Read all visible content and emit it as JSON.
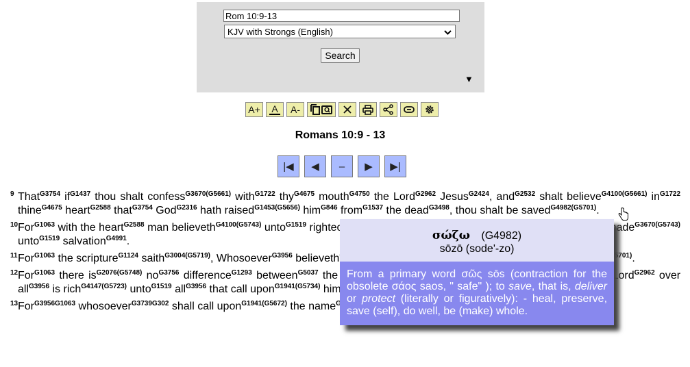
{
  "search": {
    "reference_value": "Rom 10:9-13",
    "version_selected": "KJV with Strongs (English)",
    "search_label": "Search",
    "toggle_icon": "▼"
  },
  "toolbar": {
    "font_increase": "A+",
    "font_default": "A",
    "font_decrease": "A-",
    "buttons": [
      "font-increase",
      "font-default",
      "font-decrease",
      "copy-search",
      "close",
      "print",
      "share",
      "link",
      "settings"
    ]
  },
  "passage": {
    "title": "Romans 10:9 - 13"
  },
  "nav": {
    "first": "|◀",
    "prev": "◀",
    "middle": "–",
    "next": "▶",
    "last": "▶|"
  },
  "verses": [
    {
      "num": "9",
      "html": "That<sup>G3754</sup> if<sup>G1437</sup> thou shalt confess<sup>G3670(G5661)</sup> with<sup>G1722</sup> thy<sup>G4675</sup> mouth<sup>G4750</sup> the Lord<sup>G2962</sup> Jesus<sup>G2424</sup>, and<sup>G2532</sup> shalt believe<sup>G4100(G5661)</sup> in<sup>G1722</sup> thine<sup>G4675</sup> heart<sup>G2588</sup> that<sup>G3754</sup> God<sup>G2316</sup> hath raised<sup>G1453(G5656)</sup> him<sup>G846</sup> from<sup>G1537</sup> the dead<sup>G3498</sup>, thou shalt be saved<sup>G4982(G5701)</sup>."
    },
    {
      "num": "10",
      "html": "For<sup>G1063</sup> with the heart<sup>G2588</sup> man believeth<sup>G4100(G5743)</sup> unto<sup>G1519</sup> righteousness<sup>G1343</sup>; and<sup>G1161</sup> with the mouth<sup>G4750</sup> confession is made<sup>G3670(G5743)</sup> unto<sup>G1519</sup> salvation<sup>G4991</sup>."
    },
    {
      "num": "11",
      "html": "For<sup>G1063</sup> the scripture<sup>G1124</sup> saith<sup>G3004(G5719)</sup>, Whosoever<sup>G3956</sup> believeth<sup>G4100(G5723)</sup> on<sup>G1909</sup> him<sup>G846</sup> shall not<sup>G3756</sup> be ashamed<sup>G2617(G5701)</sup>."
    },
    {
      "num": "12",
      "html": "For<sup>G1063</sup> there is<sup>G2076(G5748)</sup> no<sup>G3756</sup> difference<sup>G1293</sup> between<sup>G5037</sup> the Jew<sup>G2453</sup> and<sup>G2532</sup> the Greek<sup>G1672</sup>: for<sup>G1063</sup> the same<sup>G846</sup> Lord<sup>G2962</sup> over all<sup>G3956</sup> is rich<sup>G4147(G5723)</sup> unto<sup>G1519</sup> all<sup>G3956</sup> that call upon<sup>G1941(G5734)</sup> him<sup>G846</sup>."
    },
    {
      "num": "13",
      "html": "For<sup>G3956G1063</sup> whosoever<sup>G3739G302</sup> shall call upon<sup>G1941(G5672)</sup> the name<sup>G3686</sup> of the Lord<sup>G2962</sup> shall be saved<sup>G4982(G5701)</sup>."
    }
  ],
  "popup": {
    "greek_word": "σώζω",
    "strongs_number": "(G4982)",
    "transliteration": "sōzō (sode'-zo)",
    "definition_html": "From a primary word σῶς sōs (contraction for the obsolete σάος saos, \" safe\" ); to <i>save</i>, that is, <i>deliver</i> or <i>protect</i> (literally or figuratively): - heal, preserve, save (self), do well, be (make) whole."
  }
}
